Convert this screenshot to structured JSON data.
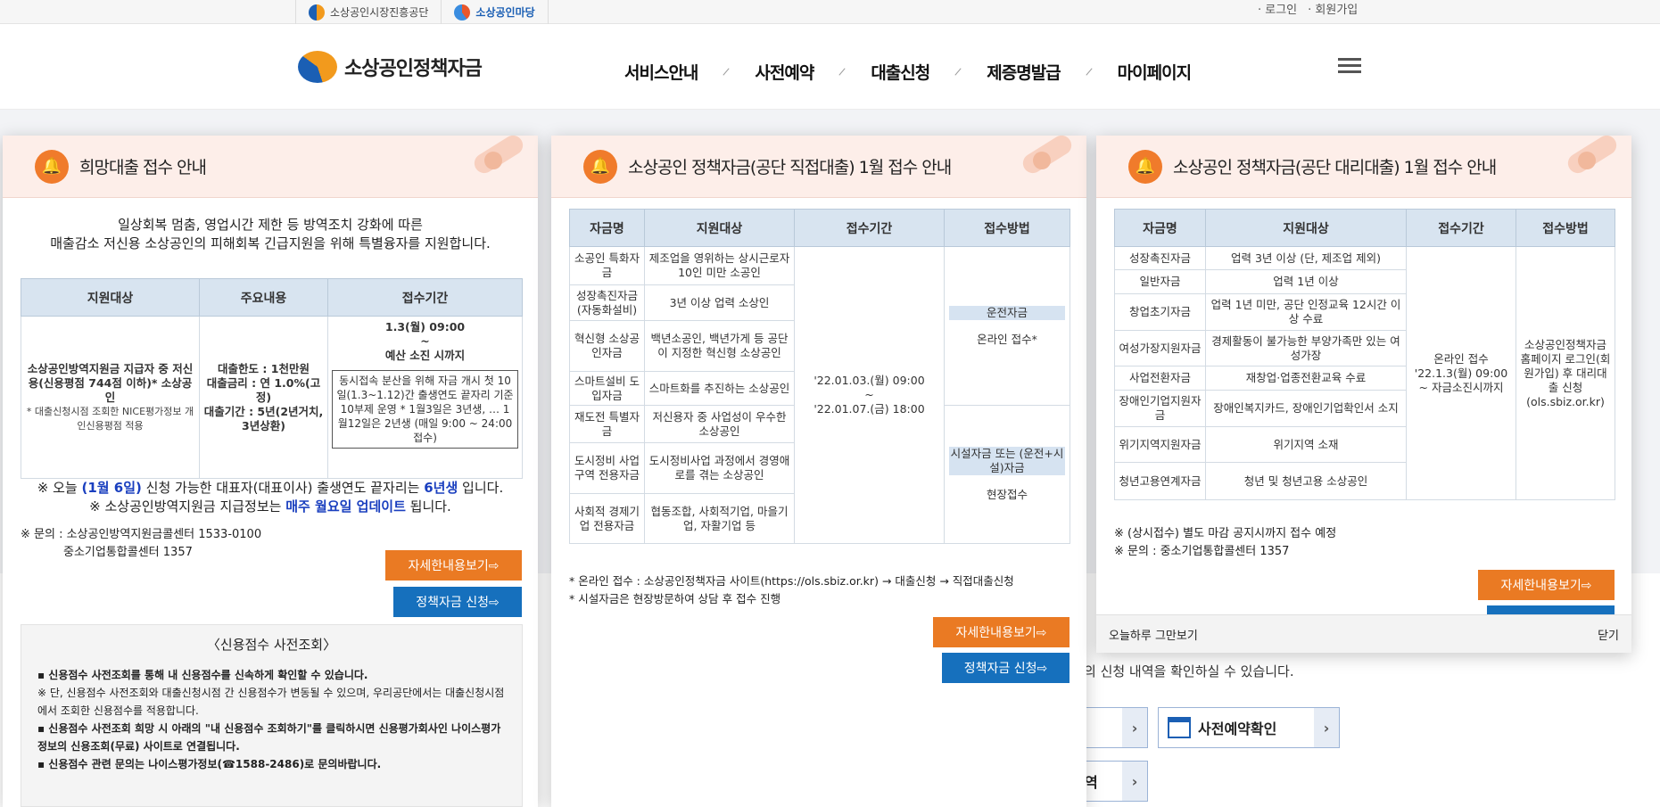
{
  "utilbar": {
    "sites": [
      "소상공인시장진흥공단",
      "소상공인마당"
    ],
    "login": "· 로그인",
    "join": "· 회원가입"
  },
  "header": {
    "logo_text": "소상공인정책자금",
    "nav": [
      "서비스안내",
      "사전예약",
      "대출신청",
      "제증명발급",
      "마이페이지"
    ]
  },
  "background": {
    "notice_text": "의 신청 내역을 확인하실 수 있습니다.",
    "reservation_check": "사전예약확인",
    "partial_label": "역"
  },
  "popup1": {
    "title": "희망대출 접수 안내",
    "intro_line1": "일상회복 멈춤, 영업시간 제한 등 방역조치 강화에 따른",
    "intro_line2": "매출감소 저신용 소상공인의 피해회복 긴급지원을 위해 특별융자를 지원합니다.",
    "headers": [
      "지원대상",
      "주요내용",
      "접수기간"
    ],
    "target_main": "소상공인방역지원금 지급자 중 저신용(신용평점 744점 이하)* 소상공인",
    "target_note": "* 대출신청시점 조회한 NICE평가정보 개인신용평점 적용",
    "content_limit": "대출한도 : 1천만원",
    "content_rate": "대출금리 : 연 1.0%(고정)",
    "content_term": "대출기간 : 5년(2년거치, 3년상환)",
    "period_start": "1.3(월) 09:00",
    "period_tilde": "~",
    "period_end": "예산 소진 시까지",
    "box_text": "동시접속 분산을 위해 자금 개시 첫 10일(1.3~1.12)간 출생연도 끝자리 기준 10부제 운영 * 1월3일은 3년생, … 1월12일은 2년생 (매일 9:00 ~ 24:00 접수)",
    "today_prefix": "※ 오늘 ",
    "today_date": "(1월 6일)",
    "today_mid": " 신청 가능한 대표자(대표이사) 출생연도 끝자리는 ",
    "today_year": "6년생",
    "today_suffix": " 입니다.",
    "update_prefix": "※ 소상공인방역지원금 지급정보는 ",
    "update_hl": "매주 월요일 업데이트",
    "update_suffix": " 됩니다.",
    "contact1": "※ 문의 : 소상공인방역지원금콜센터 1533-0100",
    "contact2": "중소기업통합콜센터 1357",
    "btn_detail": "자세한내용보기⇨",
    "btn_apply": "정책자금 신청⇨",
    "credit_title": "〈신용점수 사전조회〉",
    "credit_l1": "▪ 신용점수 사전조회를 통해 내 신용점수를 신속하게 확인할 수 있습니다.",
    "credit_l2": "※ 단, 신용점수 사전조회와 대출신청시점 간 신용점수가 변동될 수 있으며, 우리공단에서는 대출신청시점에서 조회한 신용점수를 적용합니다.",
    "credit_l3": "▪ 신용점수 사전조회 희망 시 아래의 \"내 신용점수 조회하기\"를 클릭하시면 신용평가회사인 나이스평가정보의 신용조회(무료) 사이트로 연결됩니다.",
    "credit_l4": "▪ 신용점수 관련 문의는 나이스평가정보(☎1588-2486)로 문의바랍니다."
  },
  "popup2": {
    "title": "소상공인 정책자금(공단 직접대출) 1월 접수 안내",
    "headers": [
      "자금명",
      "지원대상",
      "접수기간",
      "접수방법"
    ],
    "rows": [
      {
        "name": "소공인 특화자금",
        "target": "제조업을 영위하는 상시근로자 10인 미만 소공인"
      },
      {
        "name": "성장촉진자금 (자동화설비)",
        "target": "3년 이상 업력 소상인"
      },
      {
        "name": "혁신형 소상공인자금",
        "target": "백년소공인, 백년가게 등 공단이 지정한 혁신형 소상공인"
      },
      {
        "name": "스마트설비 도입자금",
        "target": "스마트화를 추진하는 소상공인"
      },
      {
        "name": "재도전 특별자금",
        "target": "저신용자 중 사업성이 우수한 소상공인"
      },
      {
        "name": "도시정비 사업구역 전용자금",
        "target": "도시정비사업 과정에서 경영애로를 겪는 소상공인"
      },
      {
        "name": "사회적 경제기업 전용자금",
        "target": "협동조합, 사회적기업, 마을기업, 자활기업 등"
      }
    ],
    "period_start": "'22.01.03.(월) 09:00",
    "period_tilde": "~",
    "period_end": "'22.01.07.(금) 18:00",
    "method1_tag": "운전자금",
    "method1": "온라인 접수*",
    "method2_tag": "시설자금 또는 (운전+시설)자금",
    "method2": "현장접수",
    "note1": "* 온라인 접수 : 소상공인정책자금 사이트(https://ols.sbiz.or.kr) → 대출신청 → 직접대출신청",
    "note2": "* 시설자금은 현장방문하여 상담 후 접수 진행",
    "btn_detail": "자세한내용보기⇨",
    "btn_apply": "정책자금 신청⇨"
  },
  "popup3": {
    "title": "소상공인 정책자금(공단 대리대출) 1월 접수 안내",
    "headers": [
      "자금명",
      "지원대상",
      "접수기간",
      "접수방법"
    ],
    "rows": [
      {
        "name": "성장촉진자금",
        "target": "업력 3년 이상 (단, 제조업 제외)"
      },
      {
        "name": "일반자금",
        "target": "업력 1년 이상"
      },
      {
        "name": "창업초기자금",
        "target": "업력 1년 미만, 공단 인정교육 12시간 이상 수료"
      },
      {
        "name": "여성가장지원자금",
        "target": "경제활동이 불가능한 부양가족만 있는 여성가장"
      },
      {
        "name": "사업전환자금",
        "target": "재창업·업종전환교육 수료"
      },
      {
        "name": "장애인기업지원자금",
        "target": "장애인복지카드, 장애인기업확인서 소지"
      },
      {
        "name": "위기지역지원자금",
        "target": "위기지역 소재"
      },
      {
        "name": "청년고용연계자금",
        "target": "청년 및 청년고용 소상공인"
      }
    ],
    "period": "온라인 접수 '22.1.3(월) 09:00 ~ 자금소진시까지",
    "method": "소상공인정책자금 홈페이지 로그인(회원가입) 후 대리대출 신청 (ols.sbiz.or.kr)",
    "note1": "※ (상시접수) 별도 마감 공지시까지 접수 예정",
    "note2": "※ 문의 : 중소기업통합콜센터 1357",
    "btn_detail": "자세한내용보기⇨",
    "dont_show": "오늘하루 그만보기",
    "close": "닫기"
  },
  "colors": {
    "accent_orange": "#ea7a23",
    "accent_blue": "#1670bd",
    "header_pink": "#fdeee9",
    "table_head": "#d8e4f0",
    "highlight_blue": "#1a3fbf"
  }
}
